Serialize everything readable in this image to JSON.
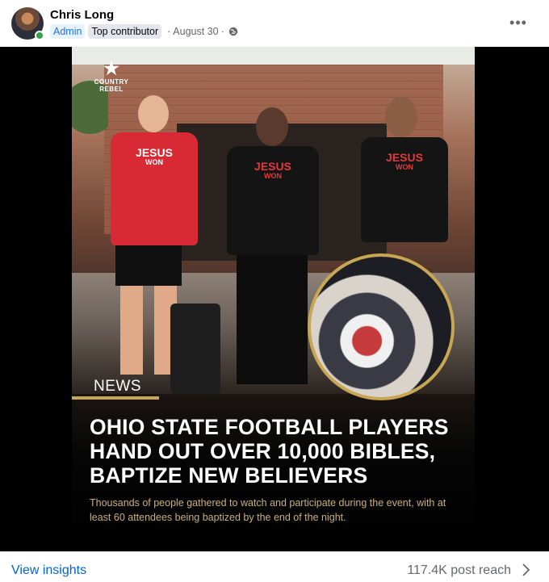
{
  "author": {
    "name": "Chris Long",
    "badges": [
      "Admin",
      "Top contributor"
    ],
    "date": "August 30",
    "separator": "·",
    "presence": "online",
    "audience_icon": "globe-icon"
  },
  "menu": {
    "icon": "more-horizontal-icon",
    "label": "•••"
  },
  "post_image": {
    "logo_text": "COUNTRY REBEL",
    "shirt_text": "JESUS",
    "shirt_subtext": "WON",
    "tag": "NEWS",
    "headline": "OHIO STATE FOOTBALL PLAYERS HAND OUT OVER 10,000 BIBLES, BAPTIZE NEW BELIEVERS",
    "subtext": "Thousands of people gathered to watch and participate during the event, with at least 60 attendees being baptized by the end of the night.",
    "accent_color": "#c8a653"
  },
  "footer": {
    "insights_label": "View insights",
    "reach_label": "117.4K post reach",
    "link_color": "#0064d1"
  }
}
